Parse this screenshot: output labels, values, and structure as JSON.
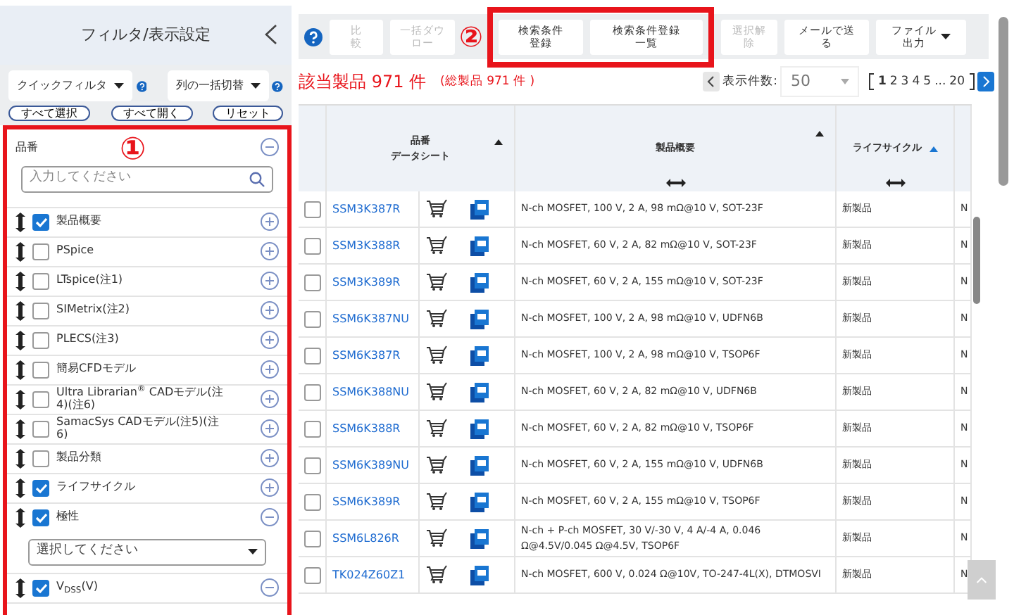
{
  "sidebar": {
    "title": "フィルタ/表示設定",
    "quick_filter": "クイックフィルタ",
    "column_toggle": "列の一括切替",
    "buttons": [
      "すべて選択",
      "すべて開く",
      "リセット"
    ],
    "marker": "①",
    "filters": [
      {
        "kind": "search",
        "label": "品番",
        "expanded": true,
        "placeholder": "入力してください"
      },
      {
        "kind": "check",
        "label": "製品概要",
        "checked": true,
        "expanded": false
      },
      {
        "kind": "check",
        "label": "PSpice",
        "checked": false,
        "expanded": false
      },
      {
        "kind": "check",
        "label": "LTspice(注1)",
        "checked": false,
        "expanded": false
      },
      {
        "kind": "check",
        "label": "SIMetrix(注2)",
        "checked": false,
        "expanded": false
      },
      {
        "kind": "check",
        "label": "PLECS(注3)",
        "checked": false,
        "expanded": false
      },
      {
        "kind": "check",
        "label": "簡易CFDモデル",
        "checked": false,
        "expanded": false
      },
      {
        "kind": "check",
        "label": "Ultra Librarian$^{®}$ CADモデル(注4)(注6)",
        "checked": false,
        "expanded": false
      },
      {
        "kind": "check",
        "label": "SamacSys CADモデル(注5)(注6)",
        "checked": false,
        "expanded": false
      },
      {
        "kind": "check",
        "label": "製品分類",
        "checked": false,
        "expanded": false
      },
      {
        "kind": "check",
        "label": "ライフサイクル",
        "checked": true,
        "expanded": false
      },
      {
        "kind": "select",
        "label": "極性",
        "checked": true,
        "expanded": true,
        "placeholder": "選択してください"
      },
      {
        "kind": "check",
        "label": "V$_{DSS}$(V)",
        "checked": true,
        "expanded": true
      }
    ]
  },
  "toolbar": {
    "marker": "②",
    "buttons": [
      {
        "label": "比較",
        "disabled": true,
        "highlighted": false
      },
      {
        "label": "一括ダウロー",
        "disabled": true,
        "highlighted": false
      },
      {
        "label": "検索条件登録",
        "disabled": false,
        "highlighted": true
      },
      {
        "label": "検索条件登録一覧",
        "disabled": false,
        "highlighted": true
      },
      {
        "label": "選択解除",
        "disabled": true,
        "highlighted": false
      },
      {
        "label": "メールで送る",
        "disabled": false,
        "highlighted": false
      },
      {
        "label": "ファイル出力",
        "disabled": false,
        "highlighted": false
      }
    ]
  },
  "results": {
    "count": "該当製品 971 件",
    "total": "(総製品 971 件 )",
    "per_page_label": "表示件数:",
    "per_page": "50",
    "pages": [
      {
        "label": "1",
        "selected": true
      },
      {
        "label": "2",
        "selected": false
      },
      {
        "label": "3",
        "selected": false
      },
      {
        "label": "4",
        "selected": false
      },
      {
        "label": "5",
        "selected": false
      },
      {
        "label": "...",
        "selected": false
      },
      {
        "label": "20",
        "selected": false
      }
    ]
  },
  "table": {
    "columns": [
      {
        "label": "品番",
        "sublabel": "データシート",
        "sorted": false
      },
      {
        "label": "製品概要",
        "sorted": false
      },
      {
        "label": "ライフサイクル",
        "sorted": true
      }
    ],
    "rows": [
      {
        "checked": false,
        "part": "SSM3K387R",
        "summary": "N-ch MOSFET, 100 V, 2 A, 98 mΩ@10 V, SOT-23F",
        "lifecycle": "新製品",
        "column_4": "N"
      },
      {
        "checked": false,
        "part": "SSM3K388R",
        "summary": "N-ch MOSFET, 60 V, 2 A, 82 mΩ@10 V, SOT-23F",
        "lifecycle": "新製品",
        "column_4": "N"
      },
      {
        "checked": false,
        "part": "SSM3K389R",
        "summary": "N-ch MOSFET, 60 V, 2 A, 155 mΩ@10 V, SOT-23F",
        "lifecycle": "新製品",
        "column_4": "N"
      },
      {
        "checked": false,
        "part": "SSM6K387NU",
        "summary": "N-ch MOSFET, 100 V, 2 A, 98 mΩ@10 V, UDFN6B",
        "lifecycle": "新製品",
        "column_4": "N"
      },
      {
        "checked": false,
        "part": "SSM6K387R",
        "summary": "N-ch MOSFET, 100 V, 2 A, 98 mΩ@10 V, TSOP6F",
        "lifecycle": "新製品",
        "column_4": "N"
      },
      {
        "checked": false,
        "part": "SSM6K388NU",
        "summary": "N-ch MOSFET, 60 V, 2 A, 82 mΩ@10 V, UDFN6B",
        "lifecycle": "新製品",
        "column_4": "N"
      },
      {
        "checked": false,
        "part": "SSM6K388R",
        "summary": "N-ch MOSFET, 60 V, 2 A, 82 mΩ@10 V, TSOP6F",
        "lifecycle": "新製品",
        "column_4": "N"
      },
      {
        "checked": false,
        "part": "SSM6K389NU",
        "summary": "N-ch MOSFET, 60 V, 2 A, 155 mΩ@10 V, UDFN6B",
        "lifecycle": "新製品",
        "column_4": "N"
      },
      {
        "checked": false,
        "part": "SSM6K389R",
        "summary": "N-ch MOSFET, 60 V, 2 A, 155 mΩ@10 V, TSOP6F",
        "lifecycle": "新製品",
        "column_4": "N"
      },
      {
        "checked": false,
        "part": "SSM6L826R",
        "summary": "N-ch + P-ch MOSFET, 30 V/-30 V, 4 A/-4 A, 0.046 Ω@4.5V/0.045 Ω@4.5V, TSOP6F",
        "lifecycle": "新製品",
        "column_4": "N"
      },
      {
        "checked": false,
        "part": "TK024Z60Z1",
        "summary": "N-ch MOSFET, 600 V, 0.024 Ω@10V, TO-247-4L(X), DTMOSVI",
        "lifecycle": "新製品",
        "column_4": "N"
      }
    ]
  }
}
